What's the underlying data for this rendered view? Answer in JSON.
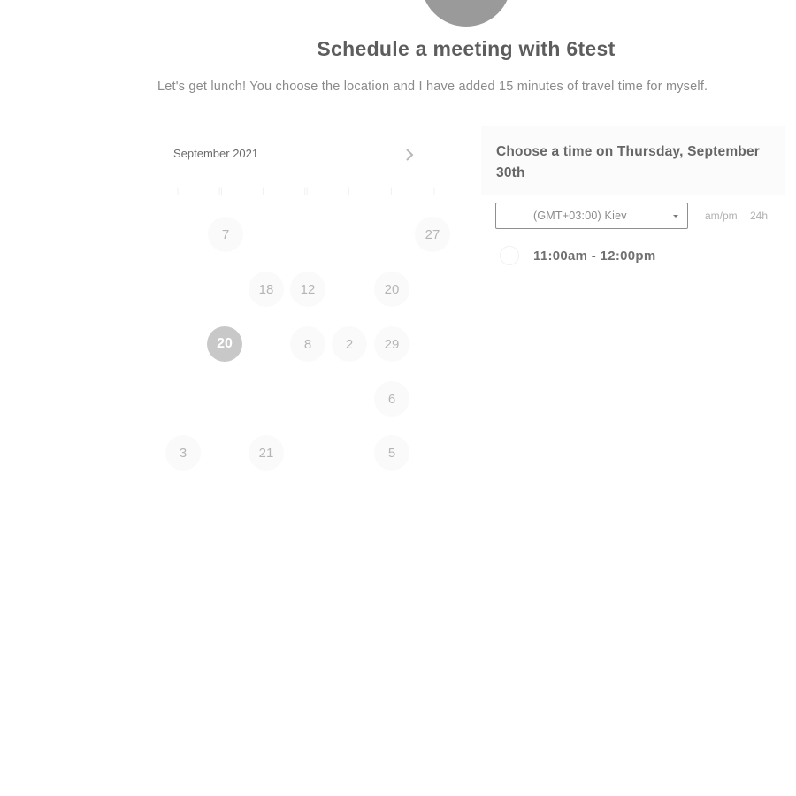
{
  "header": {
    "title": "Schedule a meeting with 6test",
    "subtitle": "Let's get lunch! You choose the location and I have added 15 minutes of travel time for myself."
  },
  "calendar": {
    "month_label": "September 2021",
    "next_icon": "chevron-right-icon",
    "days": [
      {
        "label": "7"
      },
      {
        "label": "27"
      },
      {
        "label": "18"
      },
      {
        "label": "12"
      },
      {
        "label": "20"
      },
      {
        "label": "20",
        "selected": true
      },
      {
        "label": "8"
      },
      {
        "label": "2"
      },
      {
        "label": "29"
      },
      {
        "label": "6"
      },
      {
        "label": "3"
      },
      {
        "label": "21"
      },
      {
        "label": "5"
      }
    ]
  },
  "time_picker": {
    "heading": "Choose a time on Thursday, September 30th",
    "timezone": "(GMT+03:00) Kiev",
    "format_ampm": "am/pm",
    "format_24h": "24h",
    "slots": [
      {
        "label": "11:00am - 12:00pm"
      }
    ]
  },
  "colors": {
    "avatar": "#9a9a9a",
    "selected_day": "#c8c8c8",
    "day_background": "#fafafa",
    "title_text": "#5d5d5d"
  }
}
